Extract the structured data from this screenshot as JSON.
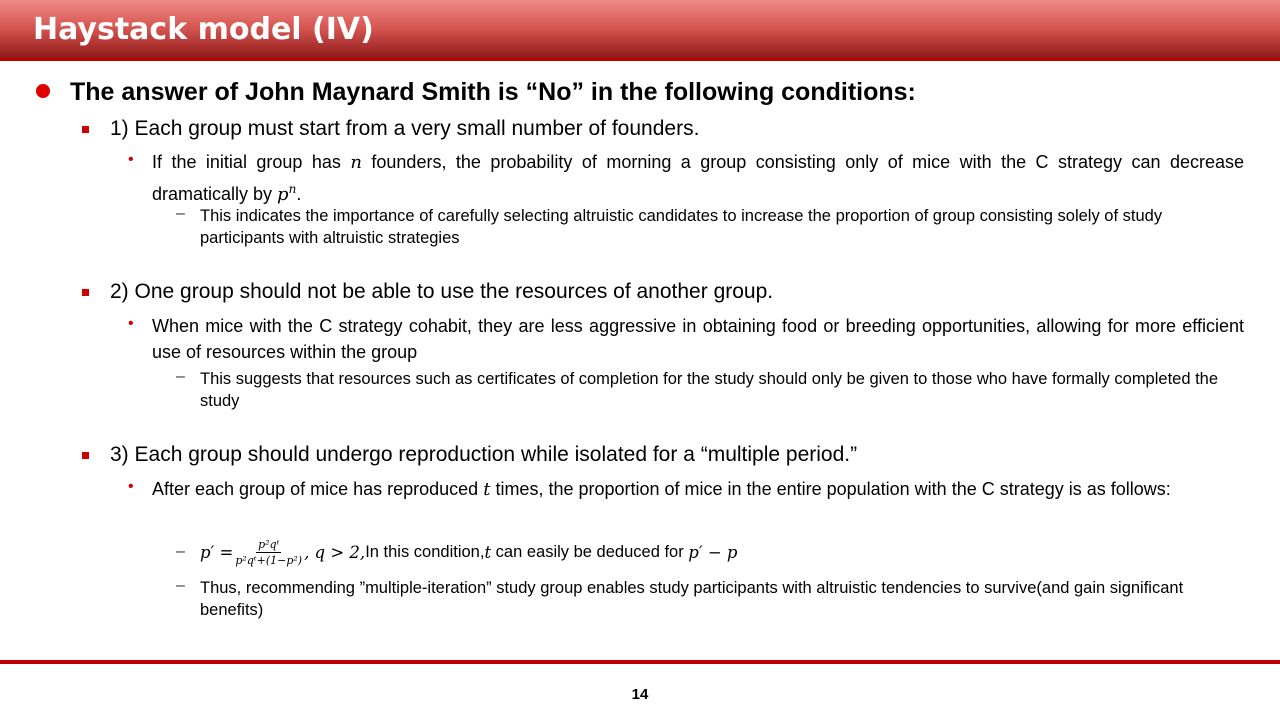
{
  "slide": {
    "title": "Haystack model (IV)",
    "page_number": "14"
  },
  "main_point": "The answer of John Maynard Smith is “No” in the following conditions:",
  "conditions": [
    {
      "label": "1) Each group must start from a very small number of founders.",
      "detail_a": " If the initial group has ",
      "detail_var": "n",
      "detail_b": " founders, the probability of morning a group consisting only of mice with the C strategy can decrease dramatically by ",
      "detail_pow_base": "p",
      "detail_pow_exp": "n",
      "detail_c": ".",
      "sub": " This indicates the importance of carefully selecting altruistic candidates to increase the proportion of group consisting solely of study participants with altruistic strategies"
    },
    {
      "label": "2) One group should not be able to use the resources of another group.",
      "detail": " When mice with the C strategy cohabit, they are less aggressive in obtaining food or breeding opportunities, allowing for more efficient use of resources within the group",
      "sub": " This suggests that resources such as certificates of completion for the study should only be given to those who have formally completed the study"
    },
    {
      "label": "3) Each group should undergo reproduction while isolated for a “multiple period.”",
      "detail_a": " After each group of mice has reproduced ",
      "detail_var": "t",
      "detail_b": " times, the proportion of mice in the entire population with the C strategy is as follows:",
      "formula_lhs": "p′ =",
      "formula_num": "p²qᵗ",
      "formula_den": "p²qᵗ+(1−p²)",
      "formula_tail_math": ", q > 2,",
      "formula_text_a": " In this condition, ",
      "formula_var": "t",
      "formula_text_b": " can easily be deduced for ",
      "formula_end": "p′ − p",
      "sub": " Thus, recommending ”multiple-iteration” study group enables study participants with altruistic tendencies to survive(and gain significant benefits)"
    }
  ],
  "colors": {
    "accent": "#c00000",
    "header_top": "#ef8a86",
    "header_bottom": "#8e1a17"
  }
}
